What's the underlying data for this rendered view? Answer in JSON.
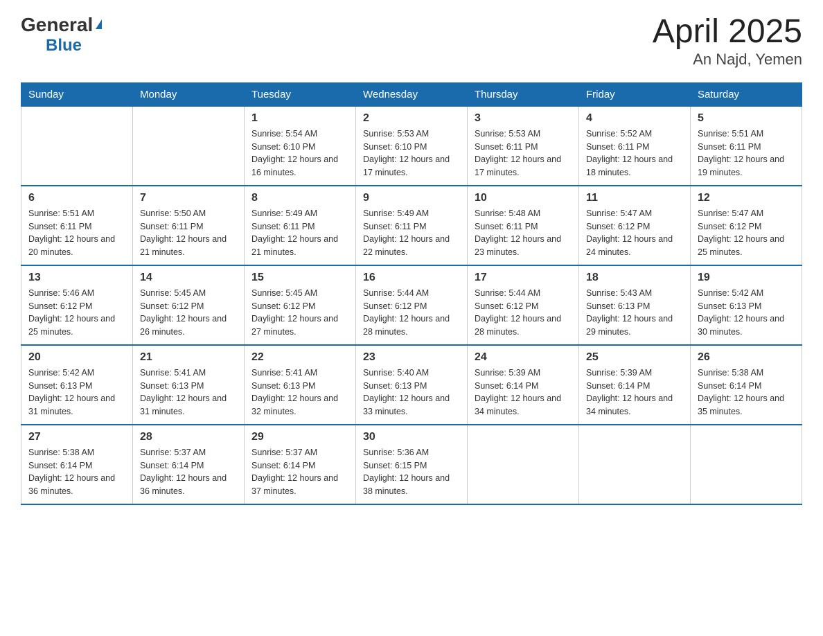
{
  "logo": {
    "general": "General",
    "blue": "Blue",
    "arrow": "▶"
  },
  "title": "April 2025",
  "subtitle": "An Najd, Yemen",
  "headers": [
    "Sunday",
    "Monday",
    "Tuesday",
    "Wednesday",
    "Thursday",
    "Friday",
    "Saturday"
  ],
  "weeks": [
    [
      {
        "day": "",
        "sunrise": "",
        "sunset": "",
        "daylight": ""
      },
      {
        "day": "",
        "sunrise": "",
        "sunset": "",
        "daylight": ""
      },
      {
        "day": "1",
        "sunrise": "Sunrise: 5:54 AM",
        "sunset": "Sunset: 6:10 PM",
        "daylight": "Daylight: 12 hours and 16 minutes."
      },
      {
        "day": "2",
        "sunrise": "Sunrise: 5:53 AM",
        "sunset": "Sunset: 6:10 PM",
        "daylight": "Daylight: 12 hours and 17 minutes."
      },
      {
        "day": "3",
        "sunrise": "Sunrise: 5:53 AM",
        "sunset": "Sunset: 6:11 PM",
        "daylight": "Daylight: 12 hours and 17 minutes."
      },
      {
        "day": "4",
        "sunrise": "Sunrise: 5:52 AM",
        "sunset": "Sunset: 6:11 PM",
        "daylight": "Daylight: 12 hours and 18 minutes."
      },
      {
        "day": "5",
        "sunrise": "Sunrise: 5:51 AM",
        "sunset": "Sunset: 6:11 PM",
        "daylight": "Daylight: 12 hours and 19 minutes."
      }
    ],
    [
      {
        "day": "6",
        "sunrise": "Sunrise: 5:51 AM",
        "sunset": "Sunset: 6:11 PM",
        "daylight": "Daylight: 12 hours and 20 minutes."
      },
      {
        "day": "7",
        "sunrise": "Sunrise: 5:50 AM",
        "sunset": "Sunset: 6:11 PM",
        "daylight": "Daylight: 12 hours and 21 minutes."
      },
      {
        "day": "8",
        "sunrise": "Sunrise: 5:49 AM",
        "sunset": "Sunset: 6:11 PM",
        "daylight": "Daylight: 12 hours and 21 minutes."
      },
      {
        "day": "9",
        "sunrise": "Sunrise: 5:49 AM",
        "sunset": "Sunset: 6:11 PM",
        "daylight": "Daylight: 12 hours and 22 minutes."
      },
      {
        "day": "10",
        "sunrise": "Sunrise: 5:48 AM",
        "sunset": "Sunset: 6:11 PM",
        "daylight": "Daylight: 12 hours and 23 minutes."
      },
      {
        "day": "11",
        "sunrise": "Sunrise: 5:47 AM",
        "sunset": "Sunset: 6:12 PM",
        "daylight": "Daylight: 12 hours and 24 minutes."
      },
      {
        "day": "12",
        "sunrise": "Sunrise: 5:47 AM",
        "sunset": "Sunset: 6:12 PM",
        "daylight": "Daylight: 12 hours and 25 minutes."
      }
    ],
    [
      {
        "day": "13",
        "sunrise": "Sunrise: 5:46 AM",
        "sunset": "Sunset: 6:12 PM",
        "daylight": "Daylight: 12 hours and 25 minutes."
      },
      {
        "day": "14",
        "sunrise": "Sunrise: 5:45 AM",
        "sunset": "Sunset: 6:12 PM",
        "daylight": "Daylight: 12 hours and 26 minutes."
      },
      {
        "day": "15",
        "sunrise": "Sunrise: 5:45 AM",
        "sunset": "Sunset: 6:12 PM",
        "daylight": "Daylight: 12 hours and 27 minutes."
      },
      {
        "day": "16",
        "sunrise": "Sunrise: 5:44 AM",
        "sunset": "Sunset: 6:12 PM",
        "daylight": "Daylight: 12 hours and 28 minutes."
      },
      {
        "day": "17",
        "sunrise": "Sunrise: 5:44 AM",
        "sunset": "Sunset: 6:12 PM",
        "daylight": "Daylight: 12 hours and 28 minutes."
      },
      {
        "day": "18",
        "sunrise": "Sunrise: 5:43 AM",
        "sunset": "Sunset: 6:13 PM",
        "daylight": "Daylight: 12 hours and 29 minutes."
      },
      {
        "day": "19",
        "sunrise": "Sunrise: 5:42 AM",
        "sunset": "Sunset: 6:13 PM",
        "daylight": "Daylight: 12 hours and 30 minutes."
      }
    ],
    [
      {
        "day": "20",
        "sunrise": "Sunrise: 5:42 AM",
        "sunset": "Sunset: 6:13 PM",
        "daylight": "Daylight: 12 hours and 31 minutes."
      },
      {
        "day": "21",
        "sunrise": "Sunrise: 5:41 AM",
        "sunset": "Sunset: 6:13 PM",
        "daylight": "Daylight: 12 hours and 31 minutes."
      },
      {
        "day": "22",
        "sunrise": "Sunrise: 5:41 AM",
        "sunset": "Sunset: 6:13 PM",
        "daylight": "Daylight: 12 hours and 32 minutes."
      },
      {
        "day": "23",
        "sunrise": "Sunrise: 5:40 AM",
        "sunset": "Sunset: 6:13 PM",
        "daylight": "Daylight: 12 hours and 33 minutes."
      },
      {
        "day": "24",
        "sunrise": "Sunrise: 5:39 AM",
        "sunset": "Sunset: 6:14 PM",
        "daylight": "Daylight: 12 hours and 34 minutes."
      },
      {
        "day": "25",
        "sunrise": "Sunrise: 5:39 AM",
        "sunset": "Sunset: 6:14 PM",
        "daylight": "Daylight: 12 hours and 34 minutes."
      },
      {
        "day": "26",
        "sunrise": "Sunrise: 5:38 AM",
        "sunset": "Sunset: 6:14 PM",
        "daylight": "Daylight: 12 hours and 35 minutes."
      }
    ],
    [
      {
        "day": "27",
        "sunrise": "Sunrise: 5:38 AM",
        "sunset": "Sunset: 6:14 PM",
        "daylight": "Daylight: 12 hours and 36 minutes."
      },
      {
        "day": "28",
        "sunrise": "Sunrise: 5:37 AM",
        "sunset": "Sunset: 6:14 PM",
        "daylight": "Daylight: 12 hours and 36 minutes."
      },
      {
        "day": "29",
        "sunrise": "Sunrise: 5:37 AM",
        "sunset": "Sunset: 6:14 PM",
        "daylight": "Daylight: 12 hours and 37 minutes."
      },
      {
        "day": "30",
        "sunrise": "Sunrise: 5:36 AM",
        "sunset": "Sunset: 6:15 PM",
        "daylight": "Daylight: 12 hours and 38 minutes."
      },
      {
        "day": "",
        "sunrise": "",
        "sunset": "",
        "daylight": ""
      },
      {
        "day": "",
        "sunrise": "",
        "sunset": "",
        "daylight": ""
      },
      {
        "day": "",
        "sunrise": "",
        "sunset": "",
        "daylight": ""
      }
    ]
  ]
}
